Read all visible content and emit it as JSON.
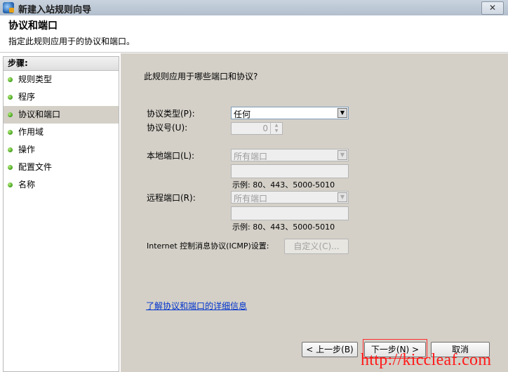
{
  "window": {
    "title": "新建入站规则向导",
    "close_label": "✕"
  },
  "header": {
    "title": "协议和端口",
    "subtitle": "指定此规则应用于的协议和端口。"
  },
  "steps": {
    "header": "步骤:",
    "items": [
      {
        "label": "规则类型"
      },
      {
        "label": "程序"
      },
      {
        "label": "协议和端口",
        "active": true
      },
      {
        "label": "作用域"
      },
      {
        "label": "操作"
      },
      {
        "label": "配置文件"
      },
      {
        "label": "名称"
      }
    ]
  },
  "form": {
    "question": "此规则应用于哪些端口和协议?",
    "protocol_type": {
      "label": "协议类型(P):",
      "value": "任何"
    },
    "protocol_number": {
      "label": "协议号(U):",
      "value": "0"
    },
    "local_port": {
      "label": "本地端口(L):",
      "value": "所有端口",
      "example": "示例: 80、443、5000-5010"
    },
    "remote_port": {
      "label": "远程端口(R):",
      "value": "所有端口",
      "example": "示例: 80、443、5000-5010"
    },
    "icmp": {
      "label": "Internet 控制消息协议(ICMP)设置:",
      "button": "自定义(C)..."
    },
    "learn_more": "了解协议和端口的详细信息"
  },
  "footer": {
    "back": "< 上一步(B)",
    "next": "下一步(N) >",
    "cancel": "取消"
  },
  "watermark": "http://kiccleaf.com",
  "icons": {
    "app": "firewall-icon",
    "step": "green-dot-icon"
  }
}
